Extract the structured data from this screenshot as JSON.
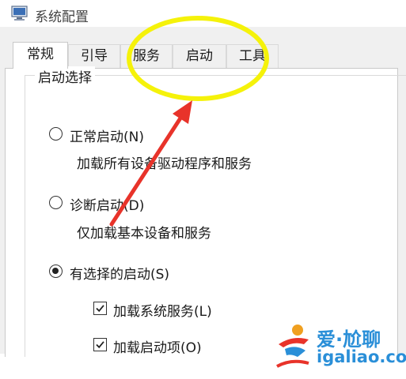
{
  "window": {
    "title": "系统配置",
    "icon": "msconfig-computer-icon"
  },
  "tabs": [
    {
      "label": "常规",
      "active": true
    },
    {
      "label": "引导",
      "active": false
    },
    {
      "label": "服务",
      "active": false
    },
    {
      "label": "启动",
      "active": false
    },
    {
      "label": "工具",
      "active": false
    }
  ],
  "startup_selection": {
    "legend": "启动选择",
    "options": [
      {
        "label": "正常启动(N)",
        "description": "加载所有设备驱动程序和服务",
        "selected": false
      },
      {
        "label": "诊断启动(D)",
        "description": "仅加载基本设备和服务",
        "selected": false
      },
      {
        "label": "有选择的启动(S)",
        "description": "",
        "selected": true
      }
    ],
    "selective_items": [
      {
        "label": "加载系统服务(L)",
        "checked": true
      },
      {
        "label": "加载启动项(O)",
        "checked": true
      }
    ]
  },
  "annotations": {
    "highlight_color": "#f5f20a",
    "arrow_color": "#e8332a"
  },
  "watermark": {
    "line1": "爱·尬聊",
    "line2": "igaliao.com",
    "color": "#2a8fd8"
  }
}
